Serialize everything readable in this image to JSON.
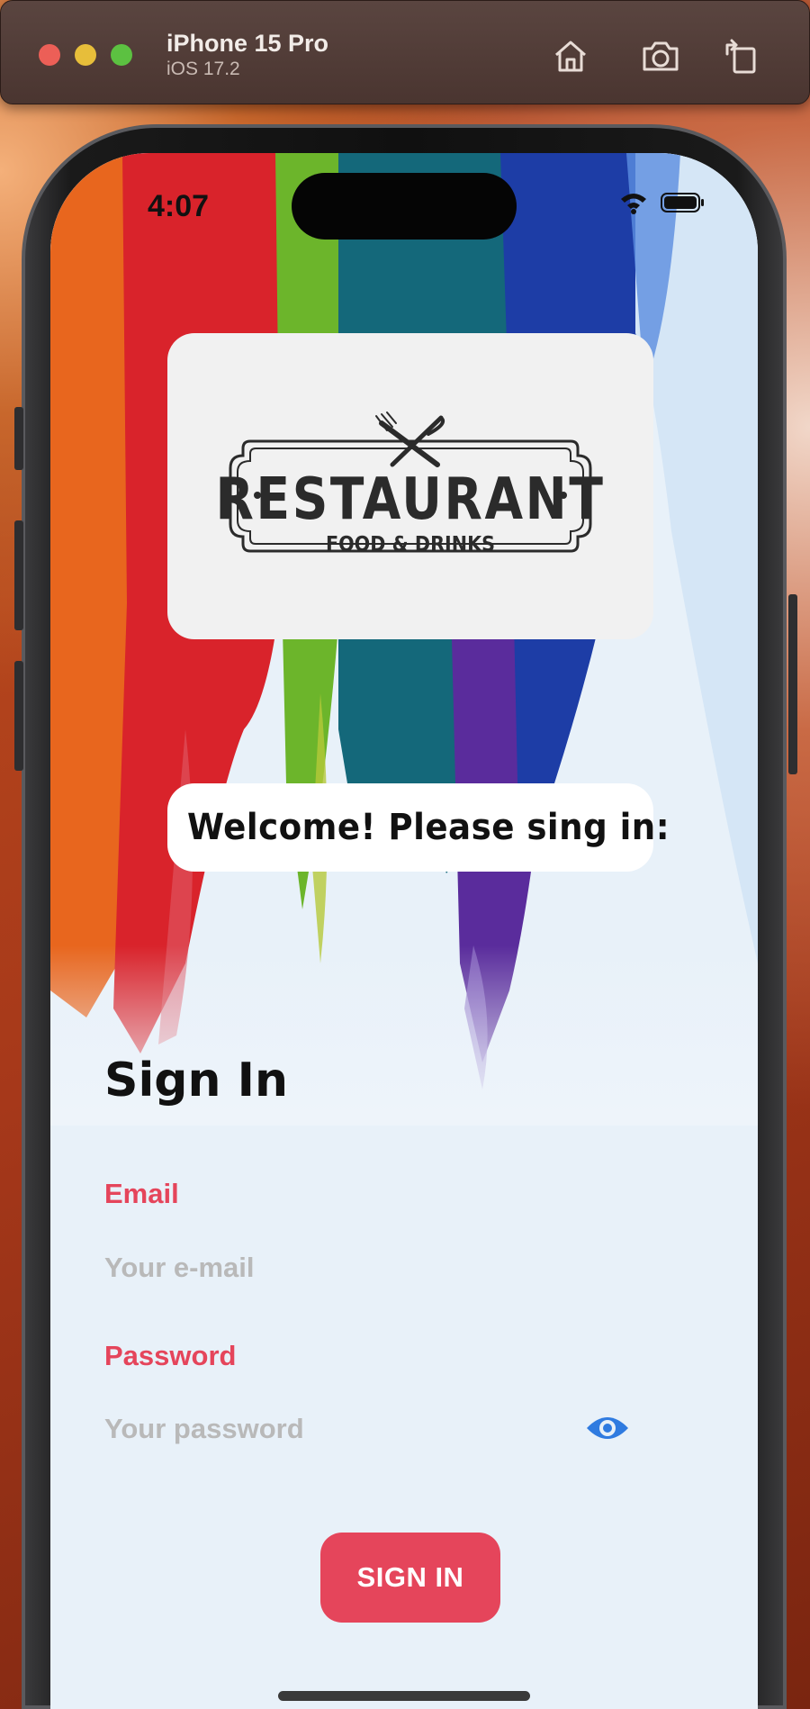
{
  "simulator": {
    "device_name": "iPhone 15 Pro",
    "os_version": "iOS 17.2",
    "toolbar_icons": [
      "home-icon",
      "screenshot-icon",
      "rotate-icon"
    ]
  },
  "status_bar": {
    "time": "4:07",
    "icons": [
      "wifi-icon",
      "battery-icon"
    ]
  },
  "logo": {
    "word": "RESTAURANT",
    "subtitle": "FOOD & DRINKS",
    "icon": "fork-knife-icon"
  },
  "welcome": {
    "text": "Welcome! Please sing in:"
  },
  "form": {
    "heading": "Sign In",
    "email_label": "Email",
    "email_placeholder": "Your e-mail",
    "email_value": "",
    "password_label": "Password",
    "password_placeholder": "Your password",
    "password_value": "",
    "visibility_icon": "eye-icon",
    "submit_label": "SIGN IN"
  },
  "colors": {
    "accent": "#e5455b",
    "eye_icon": "#2f7be0",
    "card_background": "#f1f1f1",
    "text_dark": "#111111"
  }
}
